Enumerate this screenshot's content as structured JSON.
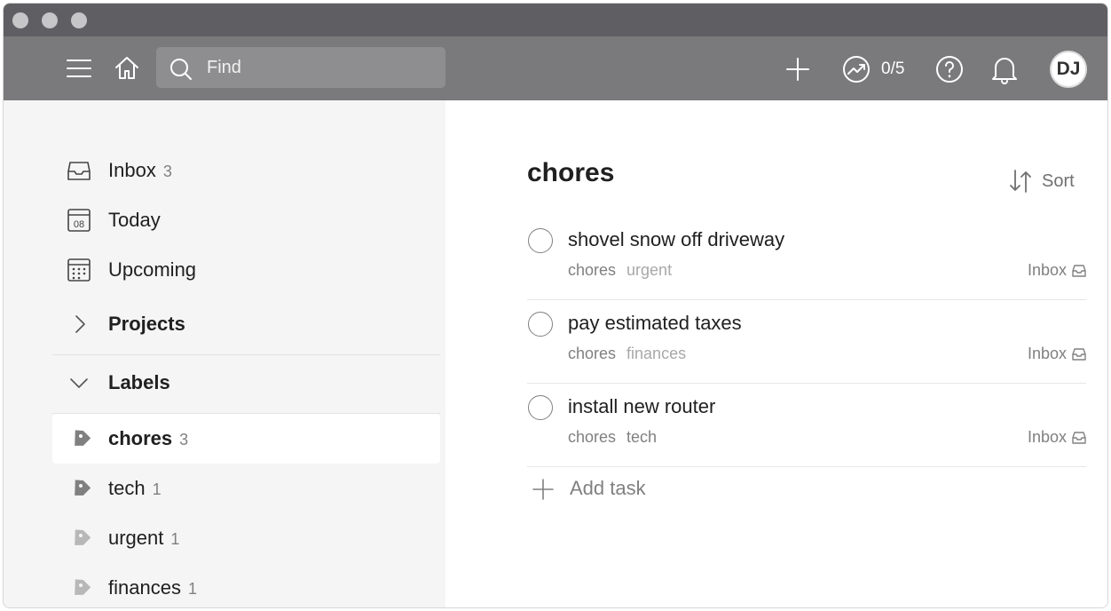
{
  "search": {
    "placeholder": "Find"
  },
  "topbar": {
    "karma": "0/5",
    "avatar_initials": "DJ"
  },
  "sidebar": {
    "nav": [
      {
        "label": "Inbox",
        "count": "3",
        "icon": "inbox-icon"
      },
      {
        "label": "Today",
        "count": "",
        "icon": "calendar-today-icon",
        "icon_text": "08"
      },
      {
        "label": "Upcoming",
        "count": "",
        "icon": "calendar-grid-icon"
      }
    ],
    "projects_label": "Projects",
    "labels_label": "Labels",
    "labels": [
      {
        "label": "chores",
        "count": "3",
        "color": "#808080"
      },
      {
        "label": "tech",
        "count": "1",
        "color": "#808080"
      },
      {
        "label": "urgent",
        "count": "1",
        "color": "#b8b8b8"
      },
      {
        "label": "finances",
        "count": "1",
        "color": "#b8b8b8"
      }
    ]
  },
  "main": {
    "title": "chores",
    "sort_label": "Sort",
    "tasks": [
      {
        "content": "shovel snow off driveway",
        "labels": [
          "chores",
          "urgent"
        ],
        "project": "Inbox"
      },
      {
        "content": "pay estimated taxes",
        "labels": [
          "chores",
          "finances"
        ],
        "project": "Inbox"
      },
      {
        "content": "install new router",
        "labels": [
          "chores",
          "tech"
        ],
        "project": "Inbox"
      }
    ],
    "add_task_label": "Add task"
  },
  "colors": {
    "topbar": "#7a7a7c",
    "titlebar": "#5f5f63",
    "sidebar_bg": "#f5f5f5"
  }
}
